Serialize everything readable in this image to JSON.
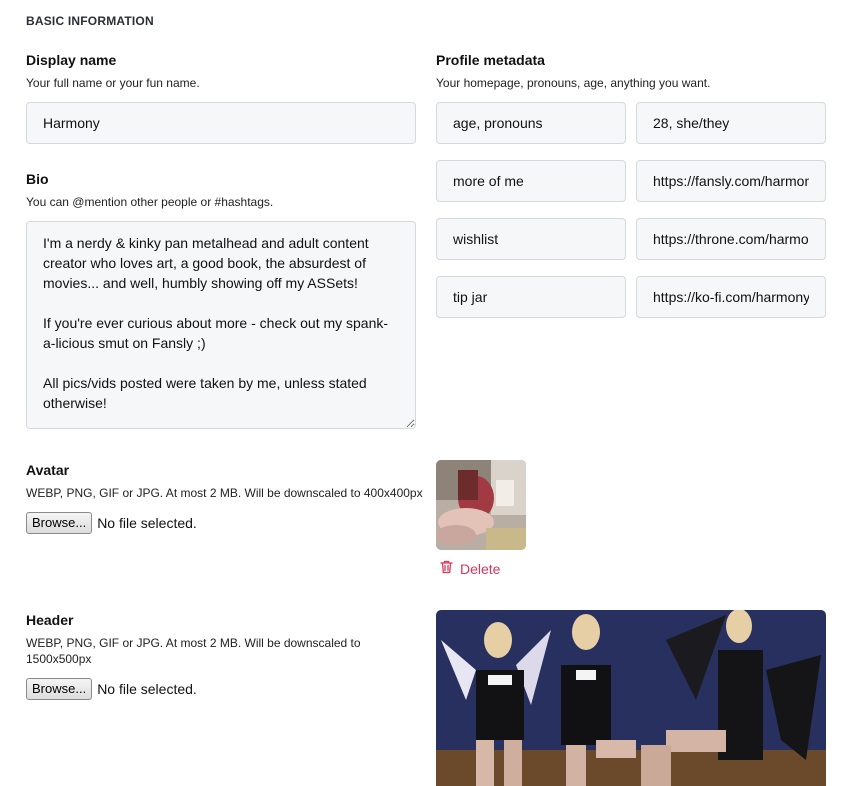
{
  "section": {
    "title": "BASIC INFORMATION"
  },
  "display_name": {
    "label": "Display name",
    "hint": "Your full name or your fun name.",
    "value": "Harmony"
  },
  "bio": {
    "label": "Bio",
    "hint": "You can @mention other people or #hashtags.",
    "value": "I'm a nerdy & kinky pan metalhead and adult content creator who loves art, a good book, the absurdest of movies... and well, humbly showing off my ASSets!\n\nIf you're ever curious about more - check out my spank-a-licious smut on Fansly ;)\n\nAll pics/vids posted were taken by me, unless stated otherwise!"
  },
  "metadata": {
    "label": "Profile metadata",
    "hint": "Your homepage, pronouns, age, anything you want.",
    "rows": [
      {
        "key": "age, pronouns",
        "value": "28, she/they"
      },
      {
        "key": "more of me",
        "value": "https://fansly.com/harmony"
      },
      {
        "key": "wishlist",
        "value": "https://throne.com/harmony"
      },
      {
        "key": "tip jar",
        "value": "https://ko-fi.com/harmony"
      }
    ]
  },
  "avatar": {
    "label": "Avatar",
    "hint": "WEBP, PNG, GIF or JPG. At most 2 MB. Will be downscaled to 400x400px",
    "browse_label": "Browse...",
    "file_status": "No file selected.",
    "delete_label": "Delete"
  },
  "header": {
    "label": "Header",
    "hint_line1": "WEBP, PNG, GIF or JPG. At most 2 MB. Will be downscaled to",
    "hint_line2": "1500x500px",
    "browse_label": "Browse...",
    "file_status": "No file selected."
  },
  "colors": {
    "accent_delete": "#d9345a",
    "field_bg": "#f6f7f9",
    "field_border": "#d5d8de"
  },
  "icons": {
    "delete": "trash-icon"
  }
}
